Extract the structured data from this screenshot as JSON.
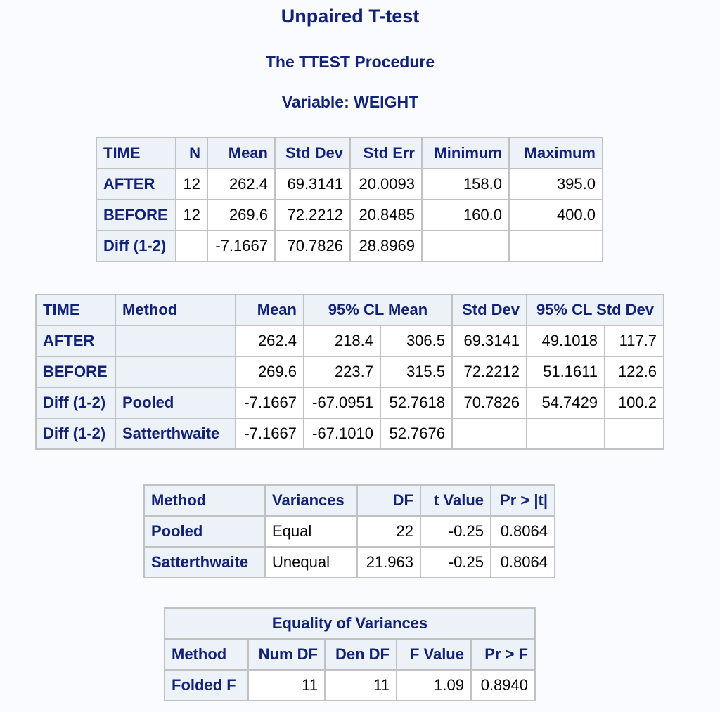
{
  "header": {
    "title": "Unpaired T-test",
    "procedure": "The TTEST Procedure",
    "variable": "Variable: WEIGHT"
  },
  "colors": {
    "header_text": "#112277",
    "header_fill": "#edf2f9",
    "border": "#c1c1c1",
    "background": "#fafbff"
  },
  "statistics_table": {
    "columns": [
      "TIME",
      "N",
      "Mean",
      "Std Dev",
      "Std Err",
      "Minimum",
      "Maximum"
    ],
    "rows": [
      {
        "time": "AFTER",
        "n": "12",
        "mean": "262.4",
        "std_dev": "69.3141",
        "std_err": "20.0093",
        "minimum": "158.0",
        "maximum": "395.0"
      },
      {
        "time": "BEFORE",
        "n": "12",
        "mean": "269.6",
        "std_dev": "72.2212",
        "std_err": "20.8485",
        "minimum": "160.0",
        "maximum": "400.0"
      },
      {
        "time": "Diff (1-2)",
        "n": "",
        "mean": "-7.1667",
        "std_dev": "70.7826",
        "std_err": "28.8969",
        "minimum": "",
        "maximum": ""
      }
    ]
  },
  "confidence_table": {
    "columns": [
      "TIME",
      "Method",
      "Mean",
      "95% CL Mean",
      "Std Dev",
      "95% CL Std Dev"
    ],
    "rows": [
      {
        "time": "AFTER",
        "method": "",
        "mean": "262.4",
        "cl_mean_lower": "218.4",
        "cl_mean_upper": "306.5",
        "std_dev": "69.3141",
        "cl_sd_lower": "49.1018",
        "cl_sd_upper": "117.7"
      },
      {
        "time": "BEFORE",
        "method": "",
        "mean": "269.6",
        "cl_mean_lower": "223.7",
        "cl_mean_upper": "315.5",
        "std_dev": "72.2212",
        "cl_sd_lower": "51.1611",
        "cl_sd_upper": "122.6"
      },
      {
        "time": "Diff (1-2)",
        "method": "Pooled",
        "mean": "-7.1667",
        "cl_mean_lower": "-67.0951",
        "cl_mean_upper": "52.7618",
        "std_dev": "70.7826",
        "cl_sd_lower": "54.7429",
        "cl_sd_upper": "100.2"
      },
      {
        "time": "Diff (1-2)",
        "method": "Satterthwaite",
        "mean": "-7.1667",
        "cl_mean_lower": "-67.1010",
        "cl_mean_upper": "52.7676",
        "std_dev": "",
        "cl_sd_lower": "",
        "cl_sd_upper": ""
      }
    ]
  },
  "ttests_table": {
    "columns": [
      "Method",
      "Variances",
      "DF",
      "t Value",
      "Pr > |t|"
    ],
    "rows": [
      {
        "method": "Pooled",
        "variances": "Equal",
        "df": "22",
        "t_value": "-0.25",
        "p_value": "0.8064"
      },
      {
        "method": "Satterthwaite",
        "variances": "Unequal",
        "df": "21.963",
        "t_value": "-0.25",
        "p_value": "0.8064"
      }
    ]
  },
  "equality_table": {
    "caption": "Equality of Variances",
    "columns": [
      "Method",
      "Num DF",
      "Den DF",
      "F Value",
      "Pr > F"
    ],
    "rows": [
      {
        "method": "Folded F",
        "num_df": "11",
        "den_df": "11",
        "f_value": "1.09",
        "p_value": "0.8940"
      }
    ]
  }
}
